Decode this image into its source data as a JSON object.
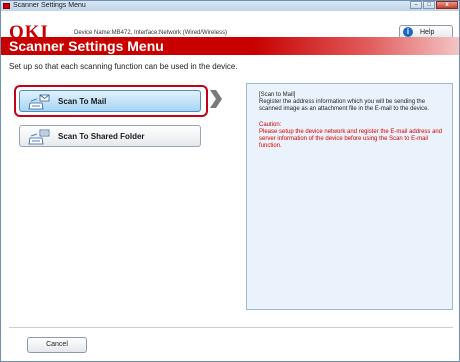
{
  "window": {
    "title": "Scanner Settings Menu",
    "controls": {
      "minimize": "‒",
      "maximize": "□",
      "close": "x"
    }
  },
  "header": {
    "logo": "OKI",
    "device_name": "Device Name:MB472, Interface:Network (Wired/Wireless)",
    "help_label": "Help",
    "help_icon": "info-icon"
  },
  "banner": {
    "title": "Scanner Settings Menu",
    "color": "#c80000"
  },
  "description": "Set up so that each scanning function can be used in the device.",
  "functions": [
    {
      "label": "Scan To Mail",
      "icon": "scan-to-mail-icon",
      "selected": true
    },
    {
      "label": "Scan To Shared Folder",
      "icon": "scan-to-folder-icon",
      "selected": false
    }
  ],
  "info_panel": {
    "heading": "[Scan to Mail]",
    "body": "Register the address information which you will be sending the scanned image as an attachment file in the E-mail to the device.",
    "caution_heading": "Caution:",
    "caution_body": "Please setup the device network and register the E-mail address and server information of the device before using the Scan to E-mail function.",
    "caution_color": "#d40000"
  },
  "footer": {
    "cancel_label": "Cancel"
  }
}
